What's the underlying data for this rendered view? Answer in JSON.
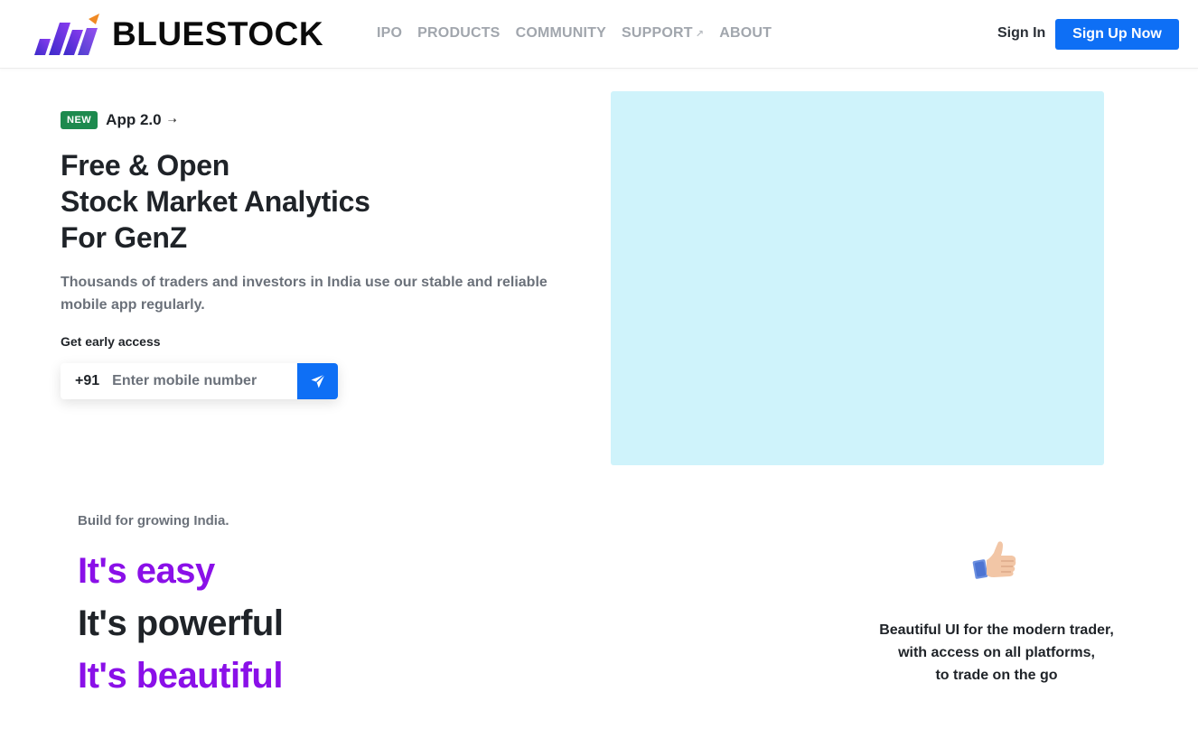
{
  "header": {
    "logo_text": "BLUESTOCK",
    "nav": [
      {
        "label": "IPO",
        "external": false
      },
      {
        "label": "PRODUCTS",
        "external": false
      },
      {
        "label": "COMMUNITY",
        "external": false
      },
      {
        "label": "SUPPORT",
        "external": true
      },
      {
        "label": "ABOUT",
        "external": false
      }
    ],
    "sign_in": "Sign In",
    "sign_up": "Sign Up Now"
  },
  "hero": {
    "badge": "NEW",
    "badge_label": "App 2.0",
    "title_lines": [
      "Free & Open",
      "Stock Market Analytics",
      "For GenZ"
    ],
    "subtitle": "Thousands of traders and investors in India use our stable and reliable mobile app regularly.",
    "early_access_label": "Get early access",
    "phone_prefix": "+91",
    "phone_placeholder": "Enter mobile number"
  },
  "lower": {
    "build_text": "Build for growing India.",
    "slogans": [
      "It's easy",
      "It's powerful",
      "It's beautiful"
    ],
    "feature_lines": [
      "Beautiful UI for the modern trader,",
      "with access on all platforms,",
      "to trade on the go"
    ]
  },
  "colors": {
    "primary_blue": "#0e6ff5",
    "purple": "#8a10e8",
    "badge_green": "#1d8a4e",
    "hero_media_bg": "#cff3fb"
  },
  "icons": {
    "logo": "bluestock-bars-logo-icon",
    "external_link": "arrow-up-right-icon",
    "badge_arrow": "arrow-right-icon",
    "send": "paper-plane-icon",
    "feature": "thumbs-up-icon"
  }
}
